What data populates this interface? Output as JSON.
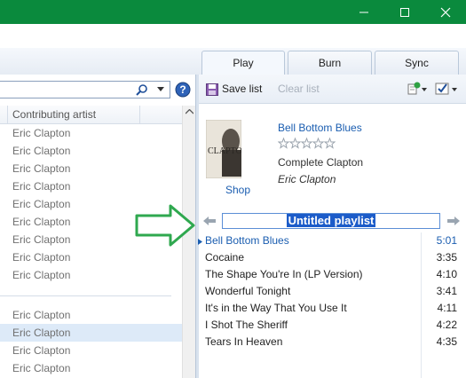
{
  "window": {
    "controls": [
      "minimize-icon",
      "maximize-icon",
      "close-icon"
    ],
    "accent": "#0a8a3d"
  },
  "tabs": [
    {
      "label": "Play",
      "active": true
    },
    {
      "label": "Burn",
      "active": false
    },
    {
      "label": "Sync",
      "active": false
    }
  ],
  "library": {
    "column_header": "Contributing artist",
    "artists": [
      "Eric Clapton",
      "Eric Clapton",
      "Eric Clapton",
      "Eric Clapton",
      "Eric Clapton",
      "Eric Clapton",
      "Eric Clapton",
      "Eric Clapton",
      "Eric Clapton"
    ],
    "artists_group2": [
      "Eric Clapton",
      "Eric Clapton",
      "Eric Clapton",
      "Eric Clapton"
    ],
    "selected_index_group2": 1
  },
  "list_pane": {
    "save_label": "Save list",
    "clear_label": "Clear list",
    "now_playing": {
      "title": "Bell Bottom Blues",
      "rating": 0,
      "album": "Complete Clapton",
      "artist": "Eric Clapton",
      "shop_label": "Shop",
      "album_art_text": "CLAPTON"
    },
    "playlist_name": "Untitled playlist",
    "tracks": [
      {
        "title": "Bell Bottom Blues",
        "duration": "5:01",
        "playing": true
      },
      {
        "title": "Cocaine",
        "duration": "3:35",
        "playing": false
      },
      {
        "title": "The Shape You're In (LP Version)",
        "duration": "4:10",
        "playing": false
      },
      {
        "title": "Wonderful Tonight",
        "duration": "3:41",
        "playing": false
      },
      {
        "title": "It's in the Way That You Use It",
        "duration": "4:11",
        "playing": false
      },
      {
        "title": "I Shot The Sheriff",
        "duration": "4:22",
        "playing": false
      },
      {
        "title": "Tears In Heaven",
        "duration": "4:35",
        "playing": false
      }
    ]
  },
  "annotation": {
    "icon": "green-arrow-icon",
    "color": "#2fa84f"
  }
}
